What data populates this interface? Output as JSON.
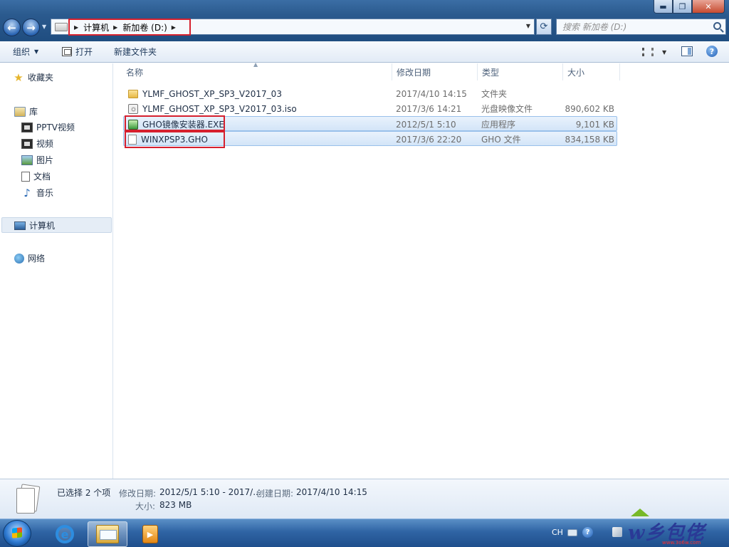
{
  "window": {
    "controls": {
      "minimize": "▬",
      "maximize": "❐",
      "close": "✕"
    }
  },
  "address_bar": {
    "crumbs": [
      "计算机",
      "新加卷 (D:)"
    ]
  },
  "search": {
    "placeholder": "搜索 新加卷 (D:)"
  },
  "toolbar": {
    "organize": "组织",
    "open": "打开",
    "new_folder": "新建文件夹"
  },
  "sidebar": {
    "favorites": "收藏夹",
    "libraries": "库",
    "library_items": [
      "PPTV视频",
      "视频",
      "图片",
      "文档",
      "音乐"
    ],
    "computer": "计算机",
    "network": "网络"
  },
  "file_list": {
    "columns": [
      "名称",
      "修改日期",
      "类型",
      "大小"
    ],
    "rows": [
      {
        "name": "YLMF_GHOST_XP_SP3_V2017_03",
        "date": "2017/4/10 14:15",
        "type": "文件夹",
        "size": "",
        "icon": "folder-icon",
        "selected": false
      },
      {
        "name": "YLMF_GHOST_XP_SP3_V2017_03.iso",
        "date": "2017/3/6 14:21",
        "type": "光盘映像文件",
        "size": "890,602 KB",
        "icon": "disc-image-icon",
        "selected": false
      },
      {
        "name": "GHO镜像安装器.EXE",
        "date": "2012/5/1 5:10",
        "type": "应用程序",
        "size": "9,101 KB",
        "icon": "application-icon",
        "selected": true
      },
      {
        "name": "WINXPSP3.GHO",
        "date": "2017/3/6 22:20",
        "type": "GHO 文件",
        "size": "834,158 KB",
        "icon": "file-icon",
        "selected": true
      }
    ]
  },
  "details_pane": {
    "selection": "已选择 2 个项",
    "modified_label": "修改日期:",
    "modified_value": "2012/5/1 5:10 - 2017/...",
    "created_label": "创建日期:",
    "created_value": "2017/4/10 14:15",
    "size_label": "大小:",
    "size_value": "823 MB"
  },
  "taskbar": {
    "language": "CH",
    "watermark_text": "w乡包佬",
    "watermark_url": "www.3o6w.com"
  },
  "colors": {
    "highlight_box": "#d6202e",
    "selection": "#d3e5f8"
  }
}
